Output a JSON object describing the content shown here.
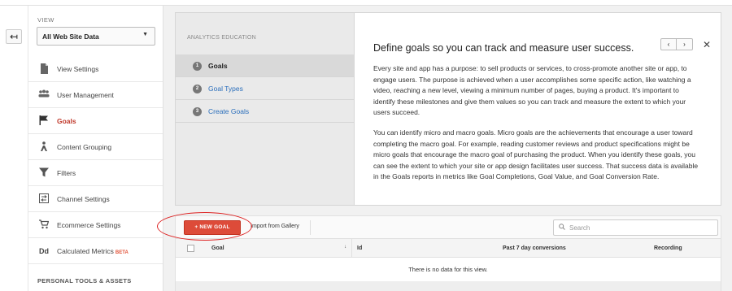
{
  "back_label": "↤",
  "view": {
    "heading": "VIEW",
    "selected": "All Web Site Data"
  },
  "nav": [
    {
      "label": "View Settings",
      "icon": "document-icon"
    },
    {
      "label": "User Management",
      "icon": "users-icon"
    },
    {
      "label": "Goals",
      "icon": "flag-icon",
      "active": true
    },
    {
      "label": "Content Grouping",
      "icon": "person-icon"
    },
    {
      "label": "Filters",
      "icon": "filter-icon"
    },
    {
      "label": "Channel Settings",
      "icon": "channel-icon"
    },
    {
      "label": "Ecommerce Settings",
      "icon": "cart-icon"
    },
    {
      "label": "Calculated Metrics",
      "icon": "dd-icon",
      "badge": "BETA"
    }
  ],
  "personal_tools": "PERSONAL TOOLS & ASSETS",
  "education": {
    "label": "ANALYTICS EDUCATION",
    "steps": [
      {
        "num": "1",
        "label": "Goals"
      },
      {
        "num": "2",
        "label": "Goal Types"
      },
      {
        "num": "3",
        "label": "Create Goals"
      }
    ],
    "title": "Define goals so you can track and measure user success.",
    "p1": "Every site and app has a purpose: to sell products or services, to cross-promote another site or app, to engage users. The purpose is achieved when a user accomplishes some specific action, like watching a video, reaching a new level, viewing a minimum number of pages, buying a product. It's important to identify these milestones and give them values so you can track and measure the extent to which your users succeed.",
    "p2": "You can identify micro and macro goals. Micro goals are the achievements that encourage a user toward completing the macro goal. For example, reading customer reviews and product specifications might be micro goals that encourage the macro goal of purchasing the product. When you identify these goals, you can see the extent to which your site or app design facilitates user success. That success data is available in the Goals reports in metrics like Goal Completions, Goal Value, and Goal Conversion Rate."
  },
  "toolbar": {
    "new_goal": "+ NEW GOAL",
    "import": "Import from Gallery",
    "search_placeholder": "Search"
  },
  "table": {
    "columns": [
      "Goal",
      "Id",
      "Past 7 day conversions",
      "Recording"
    ],
    "empty_text": "There is no data for this view."
  },
  "colors": {
    "accent_red": "#dd4b39",
    "link_blue": "#2a6ebb"
  }
}
